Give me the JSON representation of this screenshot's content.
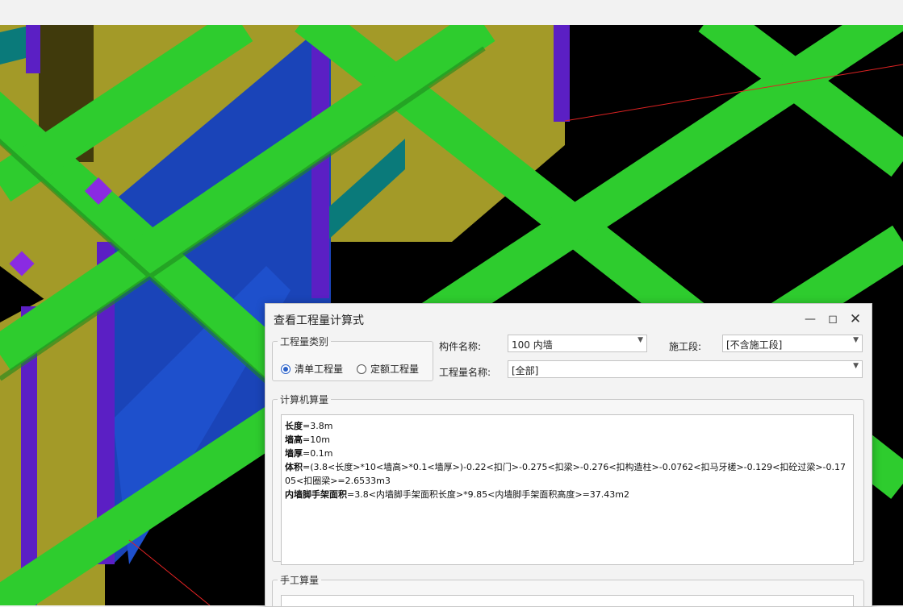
{
  "dialog": {
    "title": "查看工程量计算式",
    "minimize_icon": "minimize-icon",
    "maximize_icon": "maximize-icon",
    "close_icon": "close-icon"
  },
  "quantity_type": {
    "legend": "工程量类别",
    "options": [
      {
        "label": "清单工程量",
        "selected": true
      },
      {
        "label": "定额工程量",
        "selected": false
      }
    ]
  },
  "filters": {
    "component_label": "构件名称:",
    "component_value": "100 内墙",
    "stage_label": "施工段:",
    "stage_value": "[不含施工段]",
    "quantity_name_label": "工程量名称:",
    "quantity_name_value": "[全部]"
  },
  "computer_calc": {
    "legend": "计算机算量",
    "lines": [
      {
        "name": "长度",
        "expr": "=3.8m"
      },
      {
        "name": "墙高",
        "expr": "=10m"
      },
      {
        "name": "墙厚",
        "expr": "=0.1m"
      },
      {
        "name": "体积",
        "expr": "=(3.8<长度>*10<墙高>*0.1<墙厚>)-0.22<扣门>-0.275<扣梁>-0.276<扣构造柱>-0.0762<扣马牙槎>-0.129<扣砼过梁>-0.1705<扣圈梁>=2.6533m3"
      },
      {
        "name": "内墙脚手架面积",
        "expr": "=3.8<内墙脚手架面积长度>*9.85<内墙脚手架面积高度>=37.43m2"
      }
    ]
  },
  "manual_calc": {
    "legend": "手工算量"
  },
  "colors": {
    "beam_green": "#2ecc2e",
    "wall_olive": "#a39a28",
    "wall_blue": "#1a44b8",
    "column_purple": "#5b1fc4",
    "teal_slab": "#0a7a7a"
  }
}
